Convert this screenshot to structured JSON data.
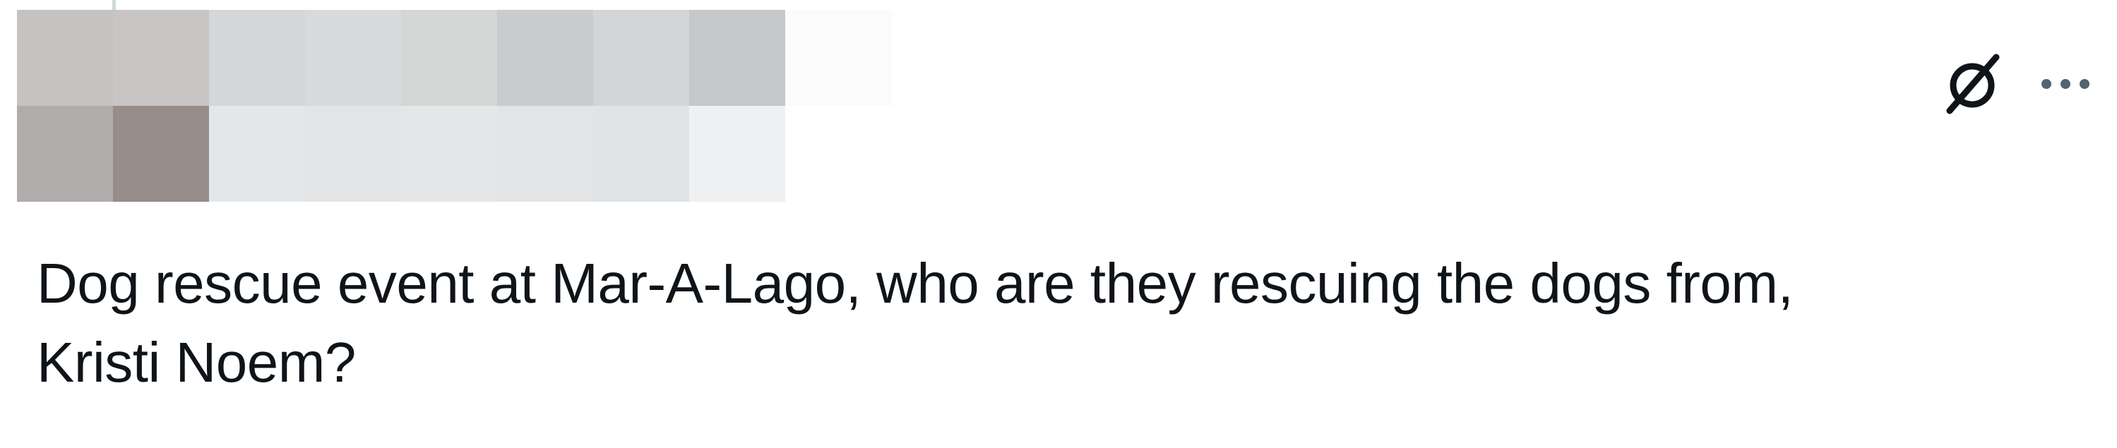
{
  "post": {
    "text": "Dog rescue event at Mar-A-Lago, who are they rescuing the dogs from,\nKristi Noem?"
  },
  "icons": {
    "grok": "grok-icon",
    "more": "more-horizontal-icon"
  },
  "colors": {
    "text": "#0f1419",
    "icon": "#0f1419",
    "more_icon": "#536471"
  }
}
